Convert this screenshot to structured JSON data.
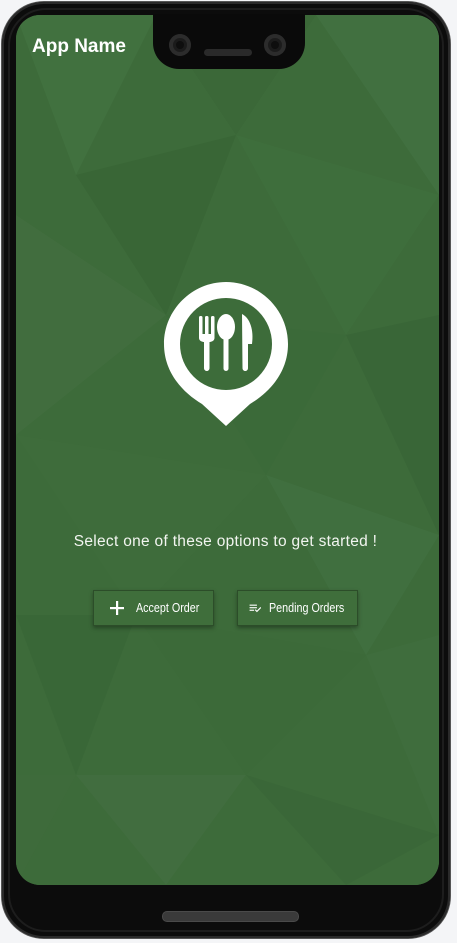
{
  "app": {
    "title": "App Name"
  },
  "content": {
    "prompt": "Select one of these options to get started !"
  },
  "actions": [
    {
      "label": "Accept Order",
      "icon": "plus-icon"
    },
    {
      "label": "Pending Orders",
      "icon": "playlist-check-icon"
    }
  ],
  "colors": {
    "background": "#3d6c3a",
    "button": "#3f6e3b",
    "text": "#ffffff"
  },
  "logo": {
    "icon": "restaurant-location-pin-icon"
  }
}
